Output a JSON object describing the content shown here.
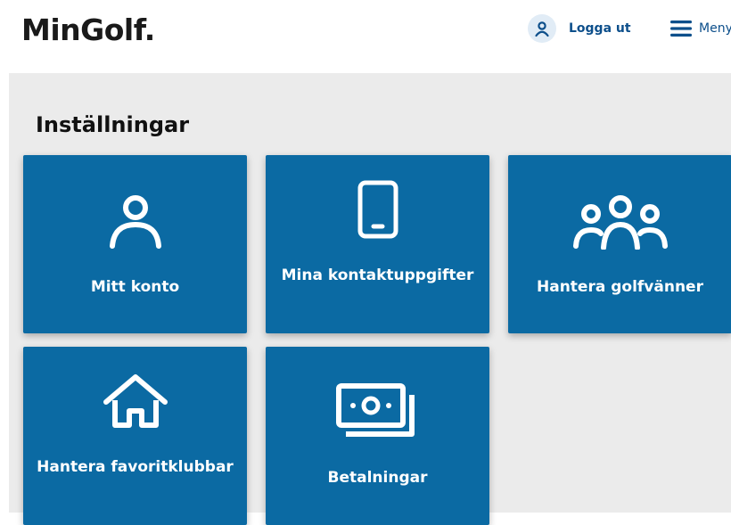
{
  "header": {
    "logo": "MinGolf.",
    "logout_label": "Logga ut",
    "menu_label": "Meny"
  },
  "page": {
    "title": "Inställningar"
  },
  "tiles": [
    {
      "label": "Mitt konto",
      "icon": "user-icon"
    },
    {
      "label": "Mina kontaktuppgifter",
      "icon": "mobile-phone-icon"
    },
    {
      "label": "Hantera golfvänner",
      "icon": "group-icon"
    },
    {
      "label": "Hantera favoritklubbar",
      "icon": "home-icon"
    },
    {
      "label": "Betalningar",
      "icon": "banknotes-icon"
    }
  ],
  "colors": {
    "tile_bg": "#0b6aa3",
    "brand_blue": "#0d4f8b",
    "panel_bg": "#ebebeb"
  }
}
